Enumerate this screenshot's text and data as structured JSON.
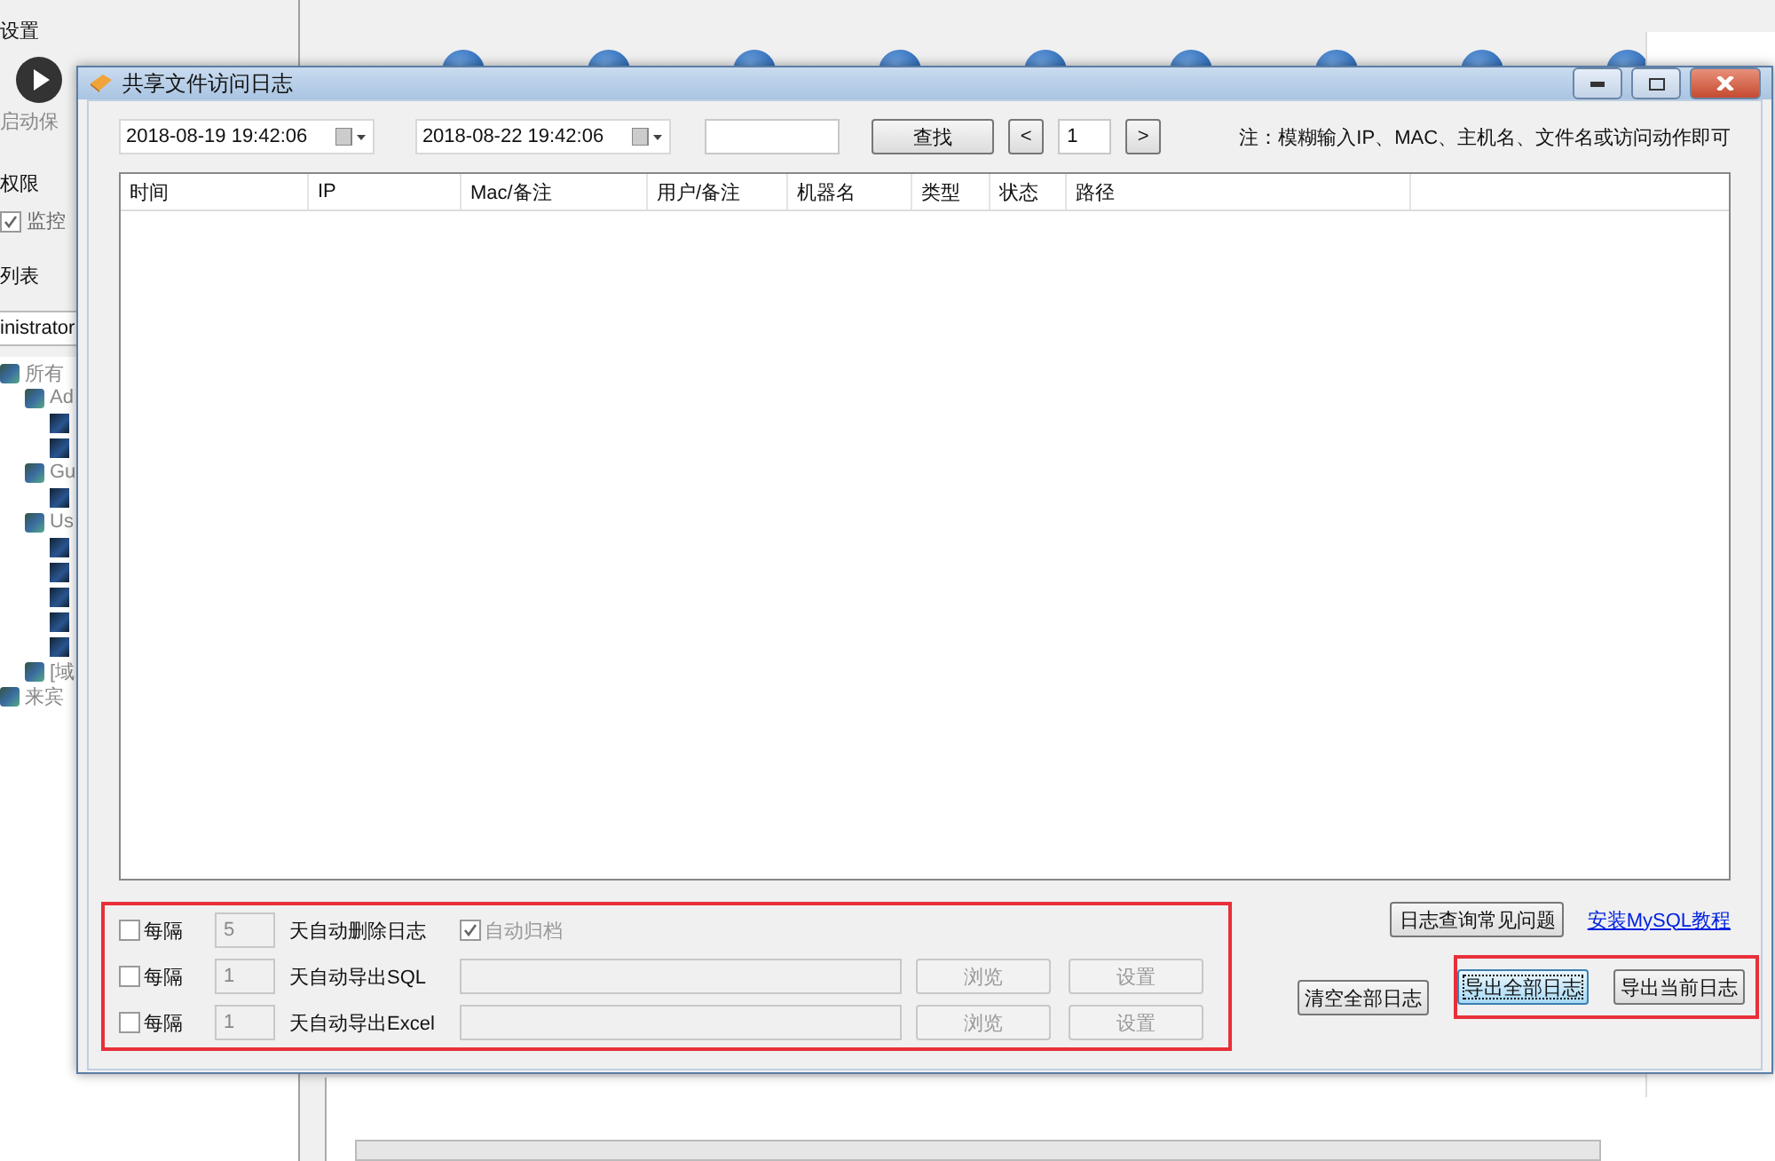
{
  "background": {
    "section_title": "设置",
    "start_label": "启动保",
    "permission_title": "权限",
    "monitor": {
      "label": "监控",
      "checked": true
    },
    "list_title": "列表",
    "user_field": "inistrator",
    "tree": [
      {
        "label": "所有",
        "children": [
          {
            "label": "Ad",
            "children": [
              {
                "kind": "user"
              },
              {
                "kind": "user"
              }
            ]
          },
          {
            "label": "Gu",
            "children": [
              {
                "kind": "user"
              }
            ]
          },
          {
            "label": "Us",
            "children": [
              {
                "kind": "user"
              },
              {
                "kind": "user"
              },
              {
                "kind": "user"
              },
              {
                "kind": "user"
              },
              {
                "kind": "user"
              }
            ]
          },
          {
            "label": "[域"
          }
        ]
      },
      {
        "label": "来宾"
      }
    ]
  },
  "dialog": {
    "title": "共享文件访问日志",
    "start_time": "2018-08-19 19:42:06",
    "end_time": "2018-08-22 19:42:06",
    "search_button": "查找",
    "prev_button": "<",
    "page": "1",
    "next_button": ">",
    "note": "注：模糊输入IP、MAC、主机名、文件名或访问动作即可",
    "table": {
      "columns": [
        "时间",
        "IP",
        "Mac/备注",
        "用户/备注",
        "机器名",
        "类型",
        "状态",
        "路径"
      ]
    },
    "auto_rows": [
      {
        "kind": "delete",
        "checked": false,
        "prefix": "每隔",
        "days": "5",
        "label": "天自动删除日志",
        "archive": {
          "label": "自动归档",
          "checked": true
        }
      },
      {
        "kind": "export",
        "checked": false,
        "prefix": "每隔",
        "days": "1",
        "label": "天自动导出SQL",
        "browse": "浏览",
        "settings": "设置"
      },
      {
        "kind": "export",
        "checked": false,
        "prefix": "每隔",
        "days": "1",
        "label": "天自动导出Excel",
        "browse": "浏览",
        "settings": "设置"
      }
    ],
    "faq_button": "日志查询常见问题",
    "mysql_link": "安装MySQL教程",
    "actions": [
      {
        "label": "清空全部日志",
        "focused": false
      },
      {
        "label": "导出全部日志",
        "focused": true
      },
      {
        "label": "导出当前日志",
        "focused": false
      }
    ]
  }
}
